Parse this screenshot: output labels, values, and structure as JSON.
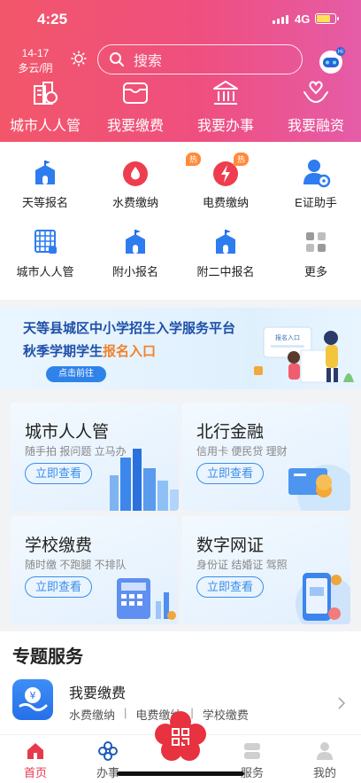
{
  "status": {
    "time": "4:25",
    "network": "4G"
  },
  "header": {
    "weather": {
      "temp": "14-17",
      "condition": "多云/阴"
    },
    "search": {
      "placeholder": "搜索"
    },
    "quick_actions": [
      {
        "label": "城市人人管",
        "icon": "city-manage-icon"
      },
      {
        "label": "我要缴费",
        "icon": "wallet-icon"
      },
      {
        "label": "我要办事",
        "icon": "government-building-icon"
      },
      {
        "label": "我要融资",
        "icon": "hands-heart-icon"
      }
    ]
  },
  "services": {
    "row1": [
      {
        "label": "天等报名",
        "icon": "school-icon"
      },
      {
        "label": "水费缴纳",
        "icon": "water-drop-icon",
        "badge": "热"
      },
      {
        "label": "电费缴纳",
        "icon": "lightning-icon",
        "badge": "热"
      },
      {
        "label": "E证助手",
        "icon": "user-gear-icon"
      }
    ],
    "row2": [
      {
        "label": "城市人人管",
        "icon": "grid-doc-icon"
      },
      {
        "label": "附小报名",
        "icon": "school-icon"
      },
      {
        "label": "附二中报名",
        "icon": "school-icon"
      },
      {
        "label": "更多",
        "icon": "more-grid-icon"
      }
    ]
  },
  "banner": {
    "line1": "天等县城区中小学招生入学服务平台",
    "line2_prefix": "秋季学期学生",
    "line2_accent": "报名入口",
    "button": "点击前往",
    "art_text": "报名入口"
  },
  "cards": [
    {
      "title": "城市人人管",
      "subtitle": "随手拍 报问题 立马办",
      "button": "立即查看"
    },
    {
      "title": "北行金融",
      "subtitle": "信用卡 便民贷 理财",
      "button": "立即查看"
    },
    {
      "title": "学校缴费",
      "subtitle": "随时缴 不跑腿 不排队",
      "button": "立即查看"
    },
    {
      "title": "数字网证",
      "subtitle": "身份证 结婚证 驾照",
      "button": "立即查看"
    }
  ],
  "topic": {
    "title": "专题服务",
    "item": {
      "name": "我要缴费",
      "subs": [
        "水费缴纳",
        "电费缴纳",
        "学校缴费"
      ],
      "separator": "|"
    }
  },
  "tabbar": [
    {
      "label": "首页",
      "active": true
    },
    {
      "label": "办事",
      "active": false
    },
    {
      "label": "服务",
      "active": false
    },
    {
      "label": "我的",
      "active": false
    }
  ],
  "colors": {
    "accent": "#e8394c",
    "primary_blue": "#2f82ea",
    "header_start": "#f2566a",
    "header_end": "#e55ca7"
  }
}
